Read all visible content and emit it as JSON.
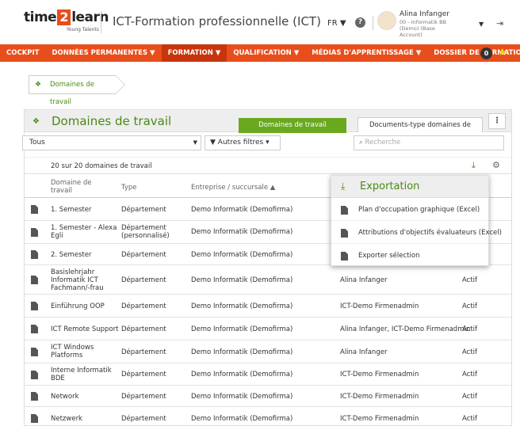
{
  "header": {
    "logo_a": "time",
    "logo_b": "2",
    "logo_c": "learn",
    "logo_tag": "Young Talents",
    "title": "ICT-Formation professionnelle (ICT)",
    "lang": "FR ▼",
    "help": "?",
    "user_name": "Alina Infanger",
    "user_sub": "00 - Informatik BB (Demo) (Base Account)",
    "user_chev": "▼",
    "logout": "⇥"
  },
  "nav": {
    "items": [
      {
        "label": "COCKPIT"
      },
      {
        "label": "DONNÉES PERMANENTES ▼"
      },
      {
        "label": "FORMATION ▼"
      },
      {
        "label": "QUALIFICATION ▼"
      },
      {
        "label": "MÉDIAS D'APPRENTISSAGE ▼"
      },
      {
        "label": "DOSSIER DE FORMATION ▼"
      }
    ],
    "badge": "0",
    "star": "★"
  },
  "breadcrumb": {
    "label": "Domaines de travail"
  },
  "panel": {
    "title": "Domaines de travail",
    "tab_active": "Domaines de travail",
    "tab_other": "Documents-type domaines de travail",
    "kebab": "⋮",
    "select_value": "Tous",
    "filters_label": "Autres filtres",
    "search_placeholder": "Recherche",
    "count": "20 sur 20 domaines de travail"
  },
  "table": {
    "headers": {
      "domain": "Domaine de travail",
      "type": "Type",
      "company": "Entreprise / succursale ▲"
    },
    "rows": [
      {
        "domain": "1. Semester",
        "type": "Département",
        "company": "Demo Informatik (Demofirma)",
        "trainer": "",
        "status": ""
      },
      {
        "domain": "1. Semester - Alexa Egli",
        "type": "Département (personnalisé)",
        "company": "Demo Informatik (Demofirma)",
        "trainer": "",
        "status": ""
      },
      {
        "domain": "2. Semester",
        "type": "Département",
        "company": "Demo Informatik (Demofirma)",
        "trainer": "",
        "status": ""
      },
      {
        "domain": "Basislehrjahr Informatik ICT Fachmann/-frau",
        "type": "Département",
        "company": "Demo Informatik (Demofirma)",
        "trainer": "Alina Infanger",
        "status": "Actif"
      },
      {
        "domain": "Einführung OOP",
        "type": "Département",
        "company": "Demo Informatik (Demofirma)",
        "trainer": "ICT-Demo Firmenadmin",
        "status": "Actif"
      },
      {
        "domain": "ICT Remote Support",
        "type": "Département",
        "company": "Demo Informatik (Demofirma)",
        "trainer": "Alina Infanger, ICT-Demo Firmenadmin",
        "status": "Actif"
      },
      {
        "domain": "ICT Windows Platforms",
        "type": "Département",
        "company": "Demo Informatik (Demofirma)",
        "trainer": "Alina Infanger",
        "status": "Actif"
      },
      {
        "domain": "Interne Informatik BDE",
        "type": "Département",
        "company": "Demo Informatik (Demofirma)",
        "trainer": "ICT-Demo Firmenadmin",
        "status": "Actif"
      },
      {
        "domain": "Network",
        "type": "Département",
        "company": "Demo Informatik (Demofirma)",
        "trainer": "ICT-Demo Firmenadmin",
        "status": "Actif"
      },
      {
        "domain": "Netzwerk",
        "type": "Département",
        "company": "Demo Informatik (Demofirma)",
        "trainer": "ICT-Demo Firmenadmin",
        "status": "Actif"
      }
    ]
  },
  "export_popup": {
    "title": "Exportation",
    "items": [
      {
        "label": "Plan d'occupation graphique (Excel)"
      },
      {
        "label": "Attributions d'objectifs évaluateurs (Excel)"
      },
      {
        "label": "Exporter sélection"
      }
    ]
  }
}
